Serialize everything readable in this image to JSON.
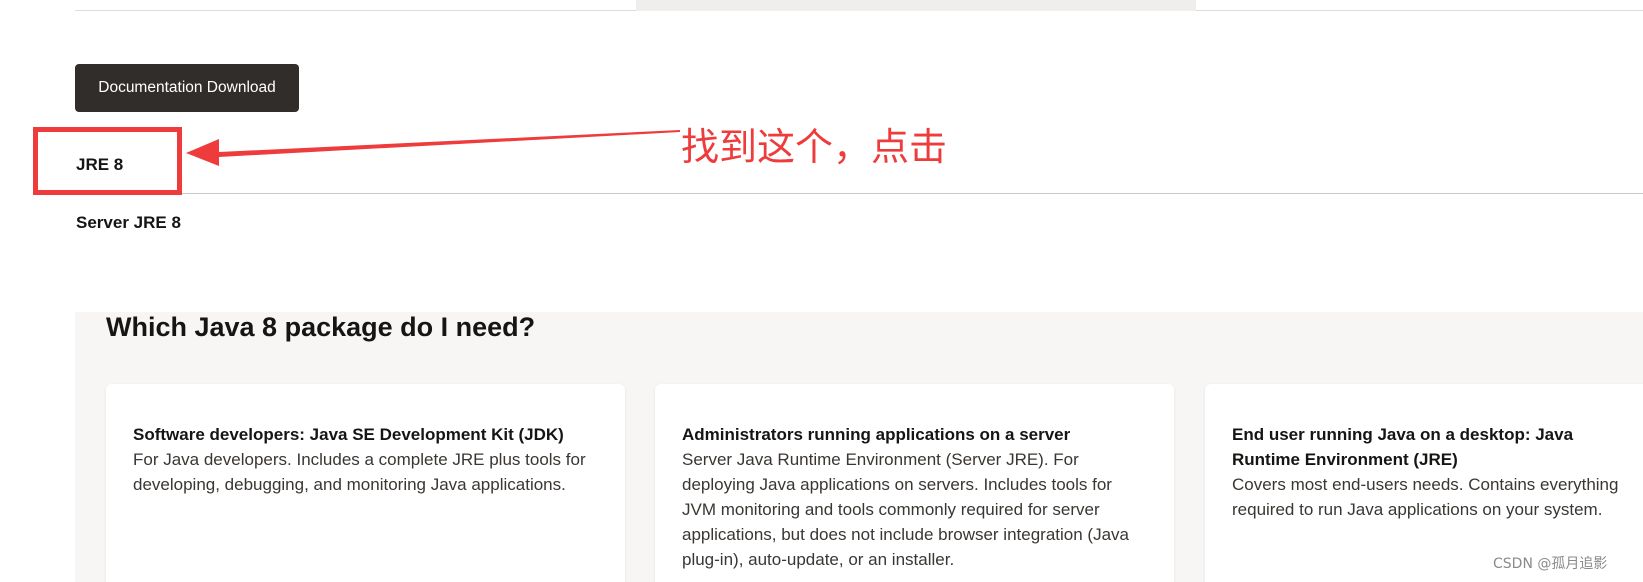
{
  "buttons": {
    "documentation_download": "Documentation Download"
  },
  "tabs": [
    {
      "label": "JRE 8"
    },
    {
      "label": "Server JRE 8"
    }
  ],
  "annotation": {
    "text": "找到这个，点击",
    "color": "#ee3b3b"
  },
  "section": {
    "title": "Which Java 8 package do I need?"
  },
  "cards": [
    {
      "heading": "Software developers: Java SE Development Kit (JDK)",
      "body": "For Java developers. Includes a complete JRE plus tools for developing, debugging, and monitoring Java applications."
    },
    {
      "heading": "Administrators running applications on a server",
      "body": "Server Java Runtime Environment (Server JRE). For deploying Java applications on servers. Includes tools for JVM monitoring and tools commonly required for server applications, but does not include browser integration (Java plug-in), auto-update, or an installer."
    },
    {
      "heading": "End user running Java on a desktop: Java Runtime Environment (JRE)",
      "body": "Covers most end-users needs. Contains everything required to run Java applications on your system."
    }
  ],
  "watermark": "CSDN @孤月追影",
  "colors": {
    "button_bg": "#312d2a",
    "section_bg": "#f7f6f4",
    "annotation_red": "#ee3b3b"
  }
}
